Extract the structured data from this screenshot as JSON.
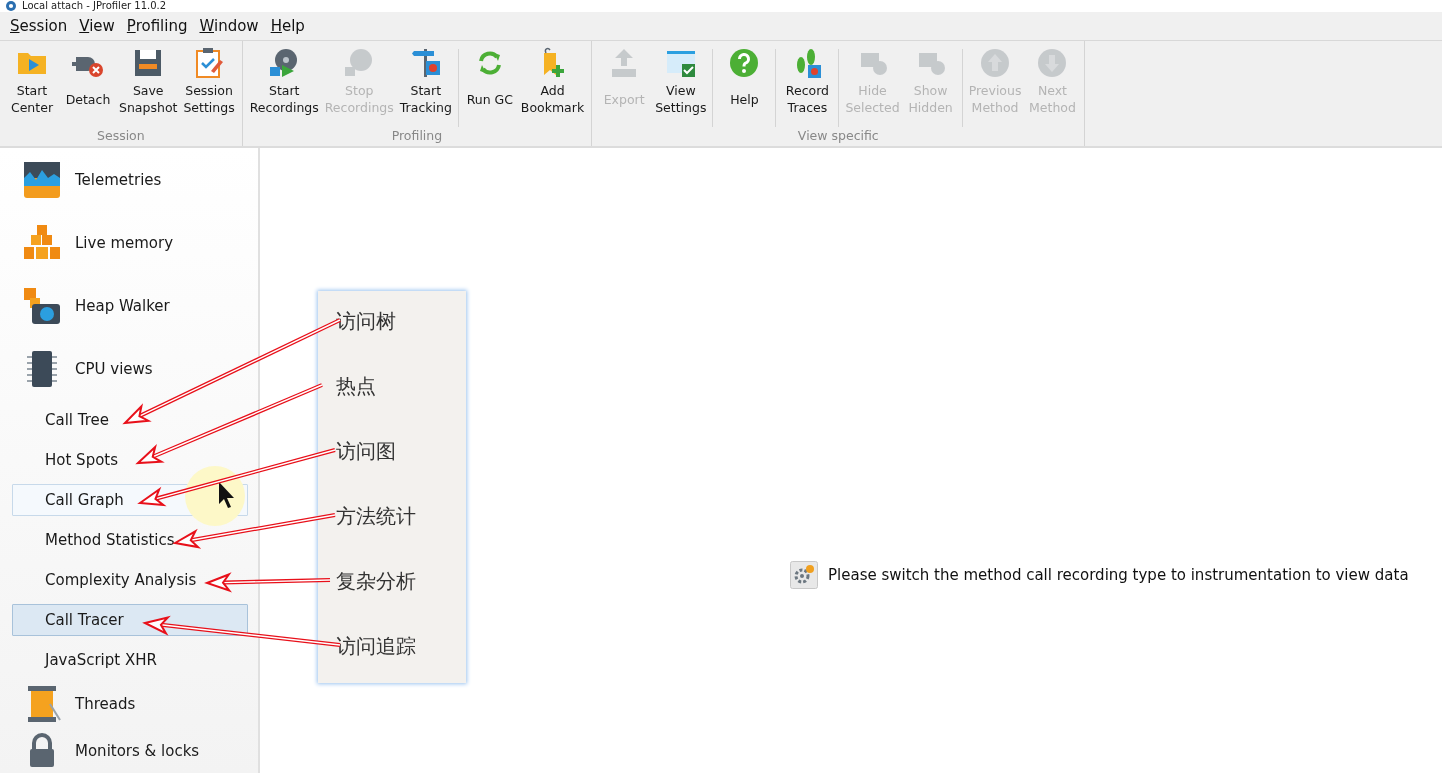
{
  "window": {
    "title": "Local attach - JProfiler 11.0.2"
  },
  "menu": [
    {
      "label": "Session"
    },
    {
      "label": "View"
    },
    {
      "label": "Profiling"
    },
    {
      "label": "Window"
    },
    {
      "label": "Help"
    }
  ],
  "toolbar": {
    "groups": [
      {
        "label": "Session",
        "clusters": [
          [
            {
              "label": "Start\nCenter",
              "disabled": false
            },
            {
              "label": "Detach",
              "disabled": false
            },
            {
              "label": "Save\nSnapshot",
              "disabled": false
            },
            {
              "label": "Session\nSettings",
              "disabled": false
            }
          ]
        ]
      },
      {
        "label": "Profiling",
        "clusters": [
          [
            {
              "label": "Start\nRecordings",
              "disabled": false
            },
            {
              "label": "Stop\nRecordings",
              "disabled": true
            },
            {
              "label": "Start\nTracking",
              "disabled": false
            }
          ],
          [
            {
              "label": "Run GC",
              "disabled": false
            },
            {
              "label": "Add\nBookmark",
              "disabled": false
            }
          ]
        ]
      },
      {
        "label": "View specific",
        "clusters": [
          [
            {
              "label": "Export",
              "disabled": true
            },
            {
              "label": "View\nSettings",
              "disabled": false
            }
          ],
          [
            {
              "label": "Help",
              "disabled": false
            }
          ],
          [
            {
              "label": "Record\nTraces",
              "disabled": false
            }
          ],
          [
            {
              "label": "Hide\nSelected",
              "disabled": true
            },
            {
              "label": "Show\nHidden",
              "disabled": true
            }
          ],
          [
            {
              "label": "Previous\nMethod",
              "disabled": true
            },
            {
              "label": "Next\nMethod",
              "disabled": true
            }
          ]
        ]
      }
    ]
  },
  "sidebar": {
    "items": [
      {
        "kind": "section",
        "label": "Telemetries"
      },
      {
        "kind": "section",
        "label": "Live memory"
      },
      {
        "kind": "section",
        "label": "Heap Walker"
      },
      {
        "kind": "section",
        "label": "CPU views",
        "children": [
          {
            "label": "Call Tree",
            "selected": false,
            "hovered": false
          },
          {
            "label": "Hot Spots",
            "selected": false,
            "hovered": false
          },
          {
            "label": "Call Graph",
            "selected": false,
            "hovered": true
          },
          {
            "label": "Method Statistics",
            "selected": false,
            "hovered": false
          },
          {
            "label": "Complexity Analysis",
            "selected": false,
            "hovered": false
          },
          {
            "label": "Call Tracer",
            "selected": true,
            "hovered": false
          },
          {
            "label": "JavaScript XHR",
            "selected": false,
            "hovered": false
          }
        ]
      },
      {
        "kind": "section",
        "label": "Threads"
      },
      {
        "kind": "section",
        "label": "Monitors & locks"
      }
    ]
  },
  "annotation": {
    "labels": [
      "访问树",
      "热点",
      "访问图",
      "方法统计",
      "复杂分析",
      "访问追踪"
    ]
  },
  "main": {
    "message": "Please switch the method call recording type to instrumentation to view data"
  }
}
